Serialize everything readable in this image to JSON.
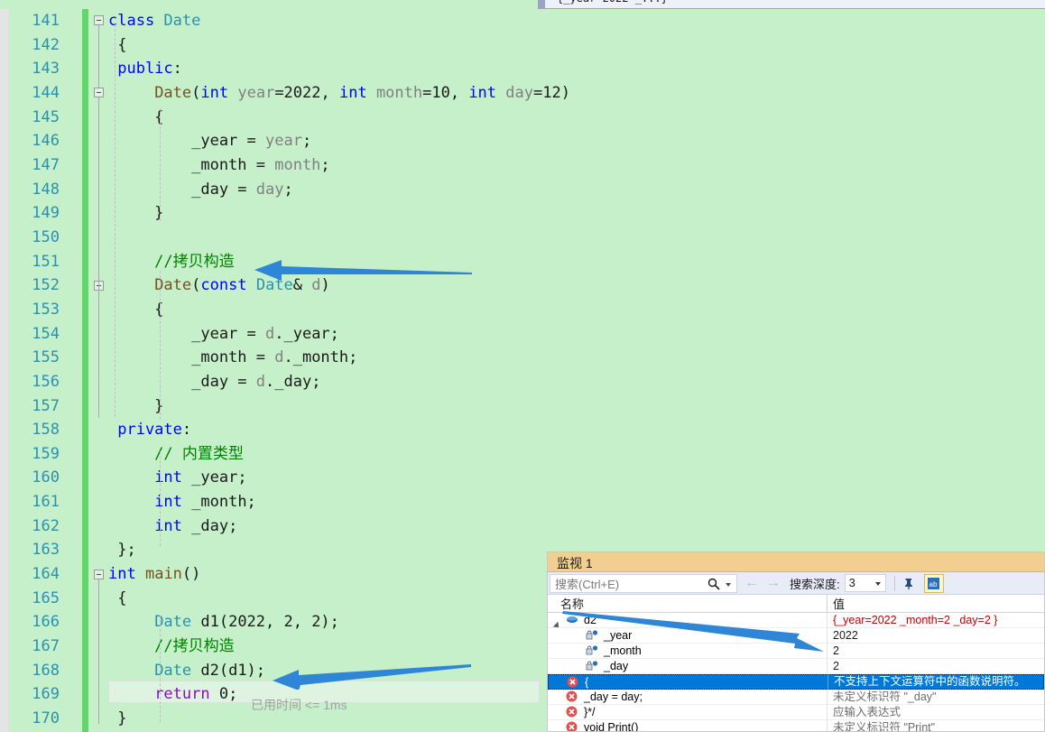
{
  "editor": {
    "language": "cpp",
    "first_line": 141,
    "background": "#c6f0ca",
    "lines": [
      {
        "num": "141",
        "tokens": [
          {
            "t": "class ",
            "c": "kw"
          },
          {
            "t": "Date",
            "c": "cls"
          }
        ]
      },
      {
        "num": "142",
        "tokens": [
          {
            "t": " {",
            "c": "plain"
          }
        ]
      },
      {
        "num": "143",
        "tokens": [
          {
            "t": " public",
            "c": "kw"
          },
          {
            "t": ":",
            "c": "plain"
          }
        ]
      },
      {
        "num": "144",
        "tokens": [
          {
            "t": "     ",
            "c": "plain"
          },
          {
            "t": "Date",
            "c": "fn"
          },
          {
            "t": "(",
            "c": "plain"
          },
          {
            "t": "int",
            "c": "kw"
          },
          {
            "t": " ",
            "c": "plain"
          },
          {
            "t": "year",
            "c": "param"
          },
          {
            "t": "=2022, ",
            "c": "plain"
          },
          {
            "t": "int",
            "c": "kw"
          },
          {
            "t": " ",
            "c": "plain"
          },
          {
            "t": "month",
            "c": "param"
          },
          {
            "t": "=10, ",
            "c": "plain"
          },
          {
            "t": "int",
            "c": "kw"
          },
          {
            "t": " ",
            "c": "plain"
          },
          {
            "t": "day",
            "c": "param"
          },
          {
            "t": "=12)",
            "c": "plain"
          }
        ]
      },
      {
        "num": "145",
        "tokens": [
          {
            "t": "     {",
            "c": "plain"
          }
        ]
      },
      {
        "num": "146",
        "tokens": [
          {
            "t": "         _year = ",
            "c": "plain"
          },
          {
            "t": "year",
            "c": "param"
          },
          {
            "t": ";",
            "c": "plain"
          }
        ]
      },
      {
        "num": "147",
        "tokens": [
          {
            "t": "         _month = ",
            "c": "plain"
          },
          {
            "t": "month",
            "c": "param"
          },
          {
            "t": ";",
            "c": "plain"
          }
        ]
      },
      {
        "num": "148",
        "tokens": [
          {
            "t": "         _day = ",
            "c": "plain"
          },
          {
            "t": "day",
            "c": "param"
          },
          {
            "t": ";",
            "c": "plain"
          }
        ]
      },
      {
        "num": "149",
        "tokens": [
          {
            "t": "     }",
            "c": "plain"
          }
        ]
      },
      {
        "num": "150",
        "tokens": [
          {
            "t": "",
            "c": "plain"
          }
        ]
      },
      {
        "num": "151",
        "tokens": [
          {
            "t": "     //拷贝构造",
            "c": "cmt"
          }
        ]
      },
      {
        "num": "152",
        "tokens": [
          {
            "t": "     ",
            "c": "plain"
          },
          {
            "t": "Date",
            "c": "fn"
          },
          {
            "t": "(",
            "c": "plain"
          },
          {
            "t": "const",
            "c": "kw"
          },
          {
            "t": " ",
            "c": "plain"
          },
          {
            "t": "Date",
            "c": "cls"
          },
          {
            "t": "& ",
            "c": "plain"
          },
          {
            "t": "d",
            "c": "param"
          },
          {
            "t": ")",
            "c": "plain"
          }
        ]
      },
      {
        "num": "153",
        "tokens": [
          {
            "t": "     {",
            "c": "plain"
          }
        ]
      },
      {
        "num": "154",
        "tokens": [
          {
            "t": "         _year = ",
            "c": "plain"
          },
          {
            "t": "d",
            "c": "param"
          },
          {
            "t": "._year;",
            "c": "plain"
          }
        ]
      },
      {
        "num": "155",
        "tokens": [
          {
            "t": "         _month = ",
            "c": "plain"
          },
          {
            "t": "d",
            "c": "param"
          },
          {
            "t": "._month;",
            "c": "plain"
          }
        ]
      },
      {
        "num": "156",
        "tokens": [
          {
            "t": "         _day = ",
            "c": "plain"
          },
          {
            "t": "d",
            "c": "param"
          },
          {
            "t": "._day;",
            "c": "plain"
          }
        ]
      },
      {
        "num": "157",
        "tokens": [
          {
            "t": "     }",
            "c": "plain"
          }
        ]
      },
      {
        "num": "158",
        "tokens": [
          {
            "t": " private",
            "c": "kw"
          },
          {
            "t": ":",
            "c": "plain"
          }
        ]
      },
      {
        "num": "159",
        "tokens": [
          {
            "t": "     // 内置类型",
            "c": "cmt"
          }
        ]
      },
      {
        "num": "160",
        "tokens": [
          {
            "t": "     ",
            "c": "plain"
          },
          {
            "t": "int",
            "c": "kw"
          },
          {
            "t": " _year;",
            "c": "plain"
          }
        ]
      },
      {
        "num": "161",
        "tokens": [
          {
            "t": "     ",
            "c": "plain"
          },
          {
            "t": "int",
            "c": "kw"
          },
          {
            "t": " _month;",
            "c": "plain"
          }
        ]
      },
      {
        "num": "162",
        "tokens": [
          {
            "t": "     ",
            "c": "plain"
          },
          {
            "t": "int",
            "c": "kw"
          },
          {
            "t": " _day;",
            "c": "plain"
          }
        ]
      },
      {
        "num": "163",
        "tokens": [
          {
            "t": " };",
            "c": "plain"
          }
        ]
      },
      {
        "num": "164",
        "tokens": [
          {
            "t": "int",
            "c": "kw"
          },
          {
            "t": " ",
            "c": "plain"
          },
          {
            "t": "main",
            "c": "fn"
          },
          {
            "t": "()",
            "c": "plain"
          }
        ]
      },
      {
        "num": "165",
        "tokens": [
          {
            "t": " {",
            "c": "plain"
          }
        ]
      },
      {
        "num": "166",
        "tokens": [
          {
            "t": "     ",
            "c": "plain"
          },
          {
            "t": "Date",
            "c": "cls"
          },
          {
            "t": " d1(2022, 2, 2);",
            "c": "plain"
          }
        ]
      },
      {
        "num": "167",
        "tokens": [
          {
            "t": "     //拷贝构造",
            "c": "cmt"
          }
        ]
      },
      {
        "num": "168",
        "tokens": [
          {
            "t": "     ",
            "c": "plain"
          },
          {
            "t": "Date",
            "c": "cls"
          },
          {
            "t": " d2(d1);",
            "c": "plain"
          }
        ]
      },
      {
        "num": "169",
        "tokens": [
          {
            "t": "     ",
            "c": "plain"
          },
          {
            "t": "return",
            "c": "ctl"
          },
          {
            "t": " ",
            "c": "plain"
          },
          {
            "t": "0",
            "c": "plain"
          },
          {
            "t": ";",
            "c": "plain"
          }
        ]
      },
      {
        "num": "170",
        "tokens": [
          {
            "t": " }",
            "c": "plain"
          }
        ]
      }
    ],
    "elapsed_time": "已用时间 <= 1ms",
    "annotation_arrow_color": "#2f86d6"
  },
  "watch": {
    "title": "监视 1",
    "search_placeholder": "搜索(Ctrl+E)",
    "search_icon": "search-icon",
    "dropdown_icon": "chevron-down-icon",
    "back_icon": "arrow-left-icon",
    "forward_icon": "arrow-right-icon",
    "depth_label": "搜索深度:",
    "depth_value": "3",
    "pin_icon": "pin-icon",
    "hex_icon": "hex-display-icon",
    "columns": [
      "名称",
      "值"
    ],
    "rows": [
      {
        "name": "d2",
        "value": "{_year=2022 _month=2 _day=2 }",
        "indent": 0,
        "icon": "object-icon",
        "expander": "expanded",
        "value_style": "red",
        "selected": false
      },
      {
        "name": "_year",
        "value": "2022",
        "indent": 1,
        "icon": "private-field-icon",
        "expander": "none",
        "value_style": "normal",
        "selected": false
      },
      {
        "name": "_month",
        "value": "2",
        "indent": 1,
        "icon": "private-field-icon",
        "expander": "none",
        "value_style": "normal",
        "selected": false
      },
      {
        "name": "_day",
        "value": "2",
        "indent": 1,
        "icon": "private-field-icon",
        "expander": "none",
        "value_style": "normal",
        "selected": false
      },
      {
        "name": "{",
        "value": "不支持上下文运算符中的函数说明符。",
        "indent": 0,
        "icon": "error-icon",
        "expander": "none",
        "value_style": "normal",
        "selected": true
      },
      {
        "name": "_day = day;",
        "value": "未定义标识符 \"_day\"",
        "indent": 0,
        "icon": "error-icon",
        "expander": "none",
        "value_style": "gray",
        "selected": false
      },
      {
        "name": "}*/",
        "value": "应输入表达式",
        "indent": 0,
        "icon": "error-icon",
        "expander": "none",
        "value_style": "gray",
        "selected": false
      },
      {
        "name": "void Print()",
        "value": "未定义标识符 \"Print\"",
        "indent": 0,
        "icon": "error-icon",
        "expander": "none",
        "value_style": "gray",
        "selected": false
      }
    ]
  },
  "colors": {
    "editor_background": "#c6f0ca",
    "keyword": "#0000ff",
    "type": "#2b91af",
    "function": "#74531f",
    "parameter": "#808080",
    "comment": "#008000",
    "control_keyword": "#8f08c4",
    "linenumber": "#2b91af",
    "arrow": "#2f86d6",
    "watch_title_bar": "#f2cf91",
    "selection": "#0078d7",
    "error_value": "#c00000"
  }
}
